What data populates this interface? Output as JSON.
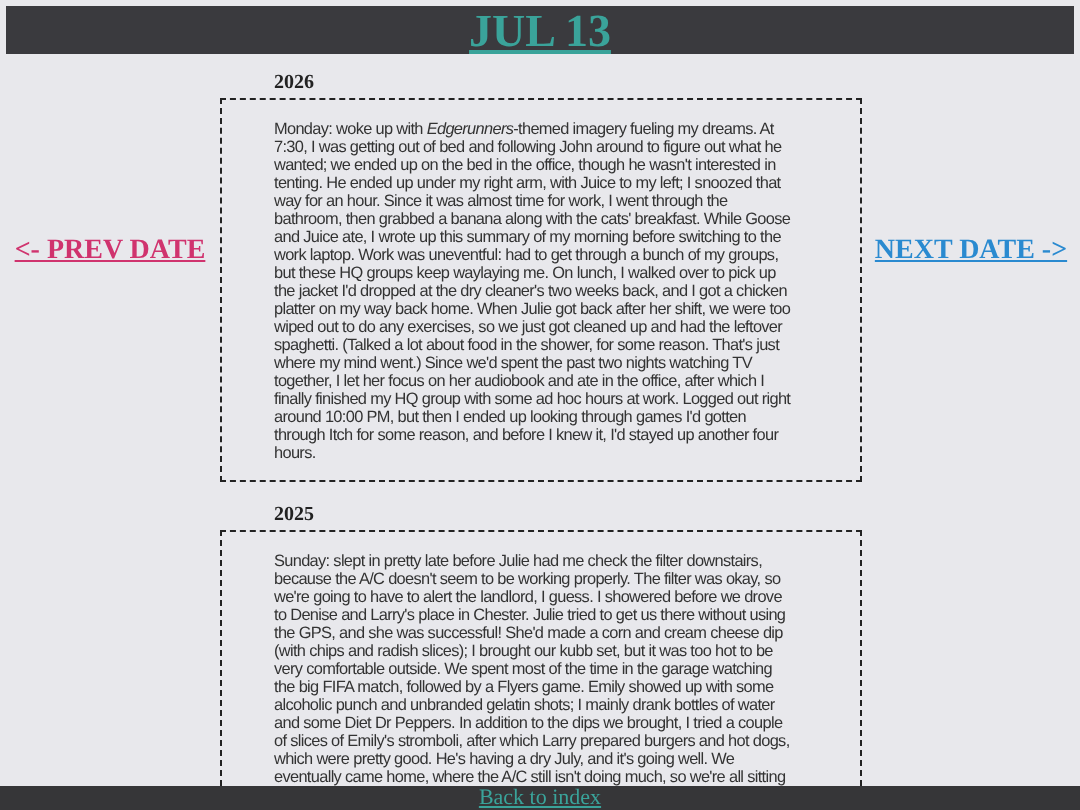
{
  "title": "JUL 13",
  "prev_link": "<- PREV DATE",
  "next_link": "NEXT DATE ->",
  "entries": [
    {
      "year": "2026",
      "text": "Monday: woke up with *Edgerunners*-themed imagery fueling my dreams. At 7:30, I was getting out of bed and following John around to figure out what he wanted; we ended up on the bed in the office, though he wasn't interested in tenting. He ended up under my right arm, with Juice to my left; I snoozed that way for an hour. Since it was almost time for work, I went through the bathroom, then grabbed a banana along with the cats' breakfast. While Goose and Juice ate, I wrote up this summary of my morning before switching to the work laptop. Work was uneventful: had to get through a bunch of my groups, but these HQ groups keep waylaying me. On lunch, I walked over to pick up the jacket I'd dropped at the dry cleaner's two weeks back, and I got a chicken platter on my way back home. When Julie got back after her shift, we were too wiped out to do any exercises, so we just got cleaned up and had the leftover spaghetti. (Talked a lot about food in the shower, for some reason. That's just where my mind went.) Since we'd spent the past two nights watching TV together, I let her focus on her audiobook and ate in the office, after which I finally finished my HQ group with some ad hoc hours at work. Logged out right around 10:00 PM, but then I ended up looking through games I'd gotten through Itch for some reason, and before I knew it, I'd stayed up another four hours."
    },
    {
      "year": "2025",
      "text": "Sunday: slept in pretty late before Julie had me check the filter downstairs, because the A/C doesn't seem to be working properly. The filter was okay, so we're going to have to alert the landlord, I guess. I showered before we drove to Denise and Larry's place in Chester. Julie tried to get us there without using the GPS, and she was successful! She'd made a corn and cream cheese dip (with chips and radish slices); I brought our kubb set, but it was too hot to be very comfortable outside. We spent most of the time in the garage watching the big FIFA match, followed by a Flyers game. Emily showed up with some alcoholic punch and unbranded gelatin shots; I mainly drank bottles of water and some Diet Dr Peppers. In addition to the dips we brought, I tried a couple of slices of Emily's stromboli, after which Larry prepared burgers and hot dogs, which were pretty good. He's having a dry July, and it's going well. We eventually came home, where the A/C still isn't doing much, so we're all sitting"
    }
  ],
  "footer_link": "Back to index"
}
